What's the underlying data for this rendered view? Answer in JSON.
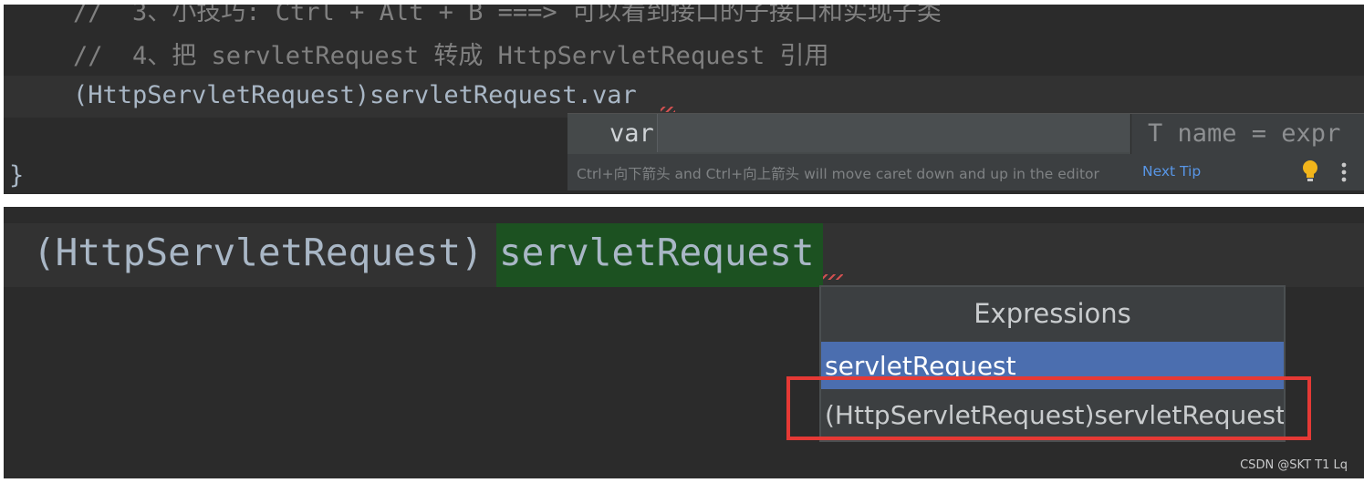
{
  "top_panel": {
    "lines": [
      {
        "text": "//  3、小技巧: Ctrl + Alt + B ===> 可以看到接口的子接口和实现子类"
      },
      {
        "text": "//  4、把 servletRequest 转成 HttpServletRequest 引用"
      },
      {
        "text": "(HttpServletRequest)servletRequest.var"
      },
      {
        "text": "}"
      }
    ],
    "live_template": {
      "input_value": "var",
      "template": "T name = expr",
      "hint": "Ctrl+向下箭头 and Ctrl+向上箭头 will move caret down and up in the editor",
      "next_tip": "Next Tip",
      "bulb_icon": "lightbulb-icon",
      "more_icon": "more-vertical-icon"
    }
  },
  "bottom_panel": {
    "code_cast": "(HttpServletRequest)",
    "code_selected": "servletRequest",
    "expressions_popup": {
      "header": "Expressions",
      "items": [
        {
          "label": "servletRequest",
          "selected": true
        },
        {
          "label": "(HttpServletRequest)servletRequest",
          "selected": false
        }
      ]
    },
    "watermark": "CSDN @SKT T1 Lq"
  },
  "colors": {
    "editor_bg": "#2b2b2b",
    "selection_green": "#1c5121",
    "popup_selected": "#4b6eaf",
    "highlight_red": "#e53935",
    "next_tip_link": "#5896e6"
  }
}
